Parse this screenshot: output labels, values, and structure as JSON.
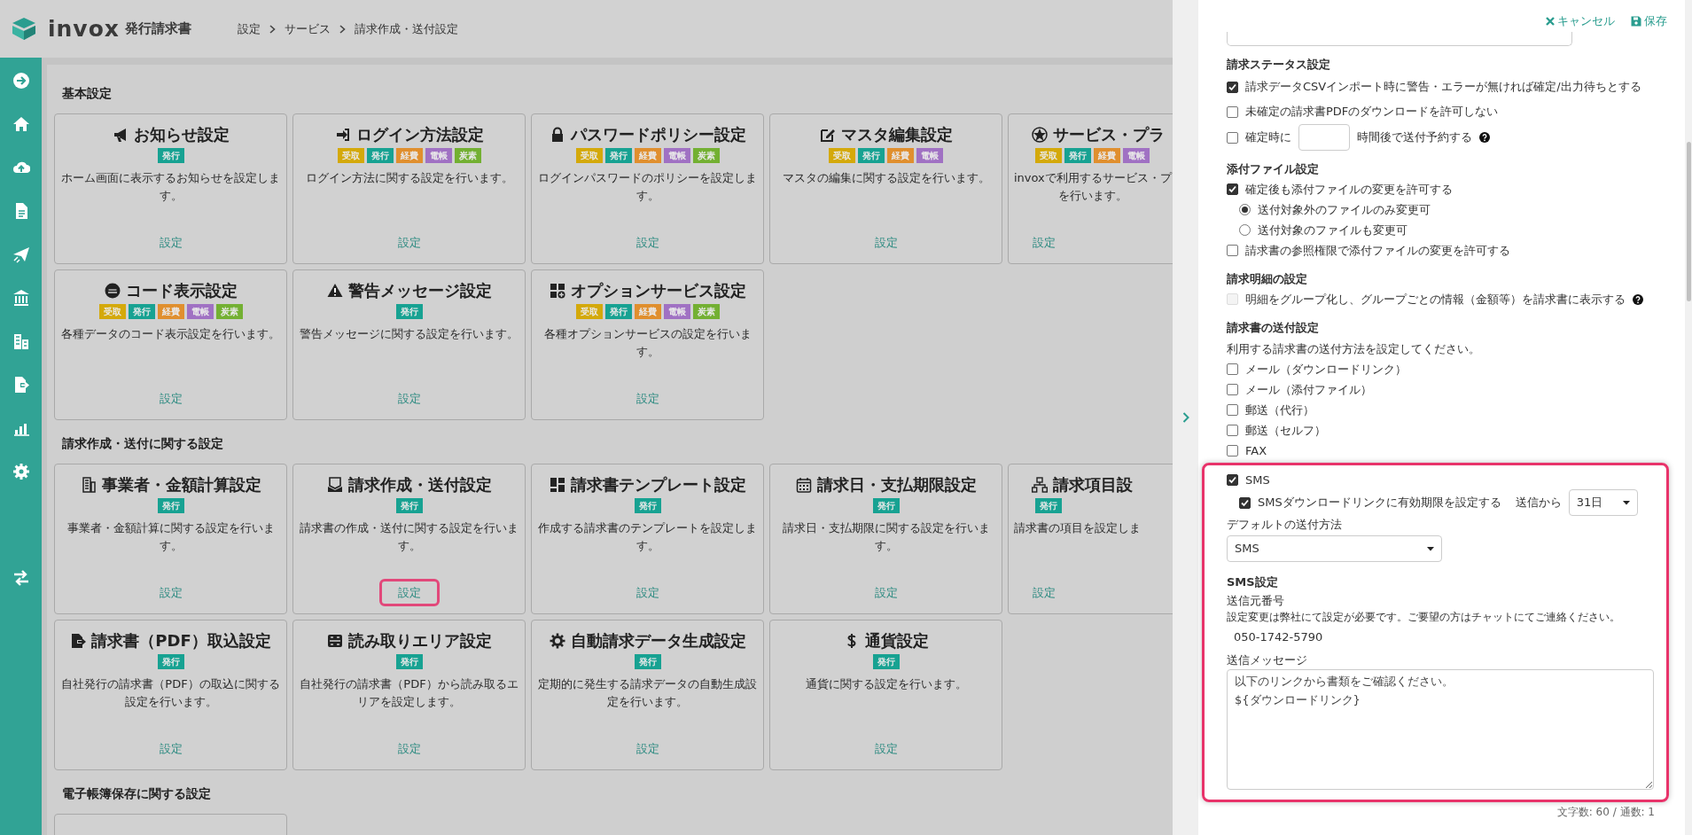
{
  "header": {
    "brand": "invox",
    "product": "発行請求書",
    "breadcrumb": [
      "設定",
      "サービス",
      "請求作成・送付設定"
    ]
  },
  "sections": [
    {
      "title": "基本設定",
      "rows": [
        [
          {
            "kind": "full",
            "title": "お知らせ設定",
            "badges": [
              {
                "label": "発行",
                "color": "#17a292"
              }
            ],
            "description": "ホーム画面に表示するお知らせを設定します。",
            "link": "設定",
            "highlighted": false
          },
          {
            "kind": "full",
            "title": "ログイン方法設定",
            "badges": [
              {
                "label": "受取",
                "color": "#d4a90a"
              },
              {
                "label": "発行",
                "color": "#17a292"
              },
              {
                "label": "経費",
                "color": "#e08f2e"
              },
              {
                "label": "電帳",
                "color": "#a071c3"
              },
              {
                "label": "炭素",
                "color": "#73b032"
              }
            ],
            "description": "ログイン方法に関する設定を行います。",
            "link": "設定",
            "highlighted": false
          },
          {
            "kind": "full",
            "title": "パスワードポリシー設定",
            "badges": [
              {
                "label": "受取",
                "color": "#d4a90a"
              },
              {
                "label": "発行",
                "color": "#17a292"
              },
              {
                "label": "経費",
                "color": "#e08f2e"
              },
              {
                "label": "電帳",
                "color": "#a071c3"
              },
              {
                "label": "炭素",
                "color": "#73b032"
              }
            ],
            "description": "ログインパスワードのポリシーを設定します。",
            "link": "設定",
            "highlighted": false
          },
          {
            "kind": "full",
            "title": "マスタ編集設定",
            "badges": [
              {
                "label": "受取",
                "color": "#d4a90a"
              },
              {
                "label": "発行",
                "color": "#17a292"
              },
              {
                "label": "経費",
                "color": "#e08f2e"
              },
              {
                "label": "電帳",
                "color": "#a071c3"
              }
            ],
            "description": "マスタの編集に関する設定を行います。",
            "link": "設定",
            "highlighted": false
          },
          {
            "kind": "cut",
            "title": "サービス・プラ",
            "badges": [
              {
                "label": "受取",
                "color": "#d4a90a"
              },
              {
                "label": "発行",
                "color": "#17a292"
              },
              {
                "label": "経費",
                "color": "#e08f2e"
              },
              {
                "label": "電帳",
                "color": "#a071c3"
              }
            ],
            "description": [
              "invoxで利用するサービス・プ",
              "を行います。"
            ],
            "link": "設定",
            "highlighted": false
          }
        ],
        [
          {
            "kind": "full",
            "title": "コード表示設定",
            "badges": [
              {
                "label": "受取",
                "color": "#d4a90a"
              },
              {
                "label": "発行",
                "color": "#17a292"
              },
              {
                "label": "経費",
                "color": "#e08f2e"
              },
              {
                "label": "電帳",
                "color": "#a071c3"
              },
              {
                "label": "炭素",
                "color": "#73b032"
              }
            ],
            "description": "各種データのコード表示設定を行います。",
            "link": "設定",
            "highlighted": false
          },
          {
            "kind": "full",
            "title": "警告メッセージ設定",
            "badges": [
              {
                "label": "発行",
                "color": "#17a292"
              }
            ],
            "description": "警告メッセージに関する設定を行います。",
            "link": "設定",
            "highlighted": false
          },
          {
            "kind": "full",
            "title": "オプションサービス設定",
            "badges": [
              {
                "label": "受取",
                "color": "#d4a90a"
              },
              {
                "label": "発行",
                "color": "#17a292"
              },
              {
                "label": "経費",
                "color": "#e08f2e"
              },
              {
                "label": "電帳",
                "color": "#a071c3"
              },
              {
                "label": "炭素",
                "color": "#73b032"
              }
            ],
            "description": "各種オプションサービスの設定を行います。",
            "link": "設定",
            "highlighted": false
          }
        ]
      ]
    },
    {
      "title": "請求作成・送付に関する設定",
      "rows": [
        [
          {
            "kind": "full",
            "title": "事業者・金額計算設定",
            "badges": [
              {
                "label": "発行",
                "color": "#17a292"
              }
            ],
            "description": "事業者・金額計算に関する設定を行います。",
            "link": "設定",
            "highlighted": false
          },
          {
            "kind": "full",
            "title": "請求作成・送付設定",
            "badges": [
              {
                "label": "発行",
                "color": "#17a292"
              }
            ],
            "description": "請求書の作成・送付に関する設定を行います。",
            "link": "設定",
            "highlighted": true
          },
          {
            "kind": "full",
            "title": "請求書テンプレート設定",
            "badges": [
              {
                "label": "発行",
                "color": "#17a292"
              }
            ],
            "description": "作成する請求書のテンプレートを設定します。",
            "link": "設定",
            "highlighted": false
          },
          {
            "kind": "full",
            "title": "請求日・支払期限設定",
            "badges": [
              {
                "label": "発行",
                "color": "#17a292"
              }
            ],
            "description": "請求日・支払期限に関する設定を行います。",
            "link": "設定",
            "highlighted": false
          },
          {
            "kind": "cut",
            "title": "請求項目設",
            "badges": [
              {
                "label": "発行",
                "color": "#17a292"
              }
            ],
            "description": "請求書の項目を設定しま",
            "link": "設定",
            "highlighted": false
          }
        ],
        [
          {
            "kind": "full",
            "title": "請求書（PDF）取込設定",
            "badges": [
              {
                "label": "発行",
                "color": "#17a292"
              }
            ],
            "description": "自社発行の請求書（PDF）の取込に関する設定を行います。",
            "link": "設定",
            "highlighted": false
          },
          {
            "kind": "full",
            "title": "読み取りエリア設定",
            "badges": [
              {
                "label": "発行",
                "color": "#17a292"
              }
            ],
            "description": "自社発行の請求書（PDF）から読み取るエリアを設定します。",
            "link": "設定",
            "highlighted": false
          },
          {
            "kind": "full",
            "title": "自動請求データ生成設定",
            "badges": [
              {
                "label": "発行",
                "color": "#17a292"
              }
            ],
            "description": "定期的に発生する請求データの自動生成設定を行います。",
            "link": "設定",
            "highlighted": false
          },
          {
            "kind": "full",
            "title": "通貨設定",
            "badges": [
              {
                "label": "発行",
                "color": "#17a292"
              }
            ],
            "description": "通貨に関する設定を行います。",
            "link": "設定",
            "highlighted": false
          }
        ]
      ]
    },
    {
      "title": "電子帳簿保存に関する設定",
      "rows": [
        [
          {
            "kind": "partial"
          }
        ]
      ]
    }
  ],
  "drawer": {
    "actions": [
      {
        "kind": "cancel",
        "label": "キャンセル"
      },
      {
        "kind": "save",
        "label": "保存"
      }
    ],
    "sections": [
      {
        "title": "請求ステータス設定",
        "options": [
          {
            "kind": "checkbox",
            "label": "請求データCSVインポート時に警告・エラーが無ければ確定/出力待ちとする",
            "checked": true,
            "disabled": false
          },
          {
            "kind": "checkbox",
            "label": "未確定の請求書PDFのダウンロードを許可しない",
            "checked": false,
            "disabled": false
          },
          {
            "kind": "checkbox_input",
            "label": "確定時に",
            "suffix": "時間後で送付予約する",
            "checked": false,
            "disabled": false
          }
        ]
      },
      {
        "title": "添付ファイル設定",
        "options": [
          {
            "kind": "checkbox",
            "label": "確定後も添付ファイルの変更を許可する",
            "checked": true,
            "disabled": false
          },
          {
            "kind": "radio",
            "label": "送付対象外のファイルのみ変更可",
            "selected": true,
            "disabled": false
          },
          {
            "kind": "radio",
            "label": "送付対象のファイルも変更可",
            "selected": false,
            "disabled": false
          },
          {
            "kind": "checkbox",
            "label": "請求書の参照権限で添付ファイルの変更を許可する",
            "checked": false,
            "disabled": false
          }
        ]
      },
      {
        "title": "請求明細の設定",
        "options": [
          {
            "kind": "checkbox_help",
            "label": "明細をグループ化し、グループごとの情報（金額等）を請求書に表示する",
            "checked": false,
            "disabled": true
          }
        ]
      },
      {
        "title": "請求書の送付設定",
        "note": "利用する請求書の送付方法を設定してください。",
        "options": [
          {
            "kind": "checkbox",
            "label": "メール（ダウンロードリンク）",
            "checked": false,
            "disabled": false
          },
          {
            "kind": "checkbox",
            "label": "メール（添付ファイル）",
            "checked": false,
            "disabled": false
          },
          {
            "kind": "checkbox",
            "label": "郵送（代行）",
            "checked": false,
            "disabled": false
          },
          {
            "kind": "checkbox",
            "label": "郵送（セルフ）",
            "checked": false,
            "disabled": false
          },
          {
            "kind": "checkbox",
            "label": "FAX",
            "checked": false,
            "disabled": false
          }
        ]
      }
    ],
    "sms_panel": {
      "highlighted": true,
      "sms": {
        "label": "SMS",
        "checked": true
      },
      "expiry": {
        "label": "SMSダウンロードリンクに有効期限を設定する",
        "checked": true,
        "prefix": "送信から",
        "value": "31日"
      },
      "default_method": {
        "label": "デフォルトの送付方法",
        "value": "SMS"
      },
      "title": "SMS設定",
      "sender": {
        "label": "送信元番号",
        "note": "設定変更は弊社にて設定が必要です。ご要望の方はチャットにてご連絡ください。",
        "value": "050-1742-5790"
      },
      "message": {
        "label": "送信メッセージ",
        "value": "以下のリンクから書類をご確認ください。\n${ダウンロードリンク}"
      },
      "counter": "文字数: 60 / 通数: 1"
    }
  }
}
